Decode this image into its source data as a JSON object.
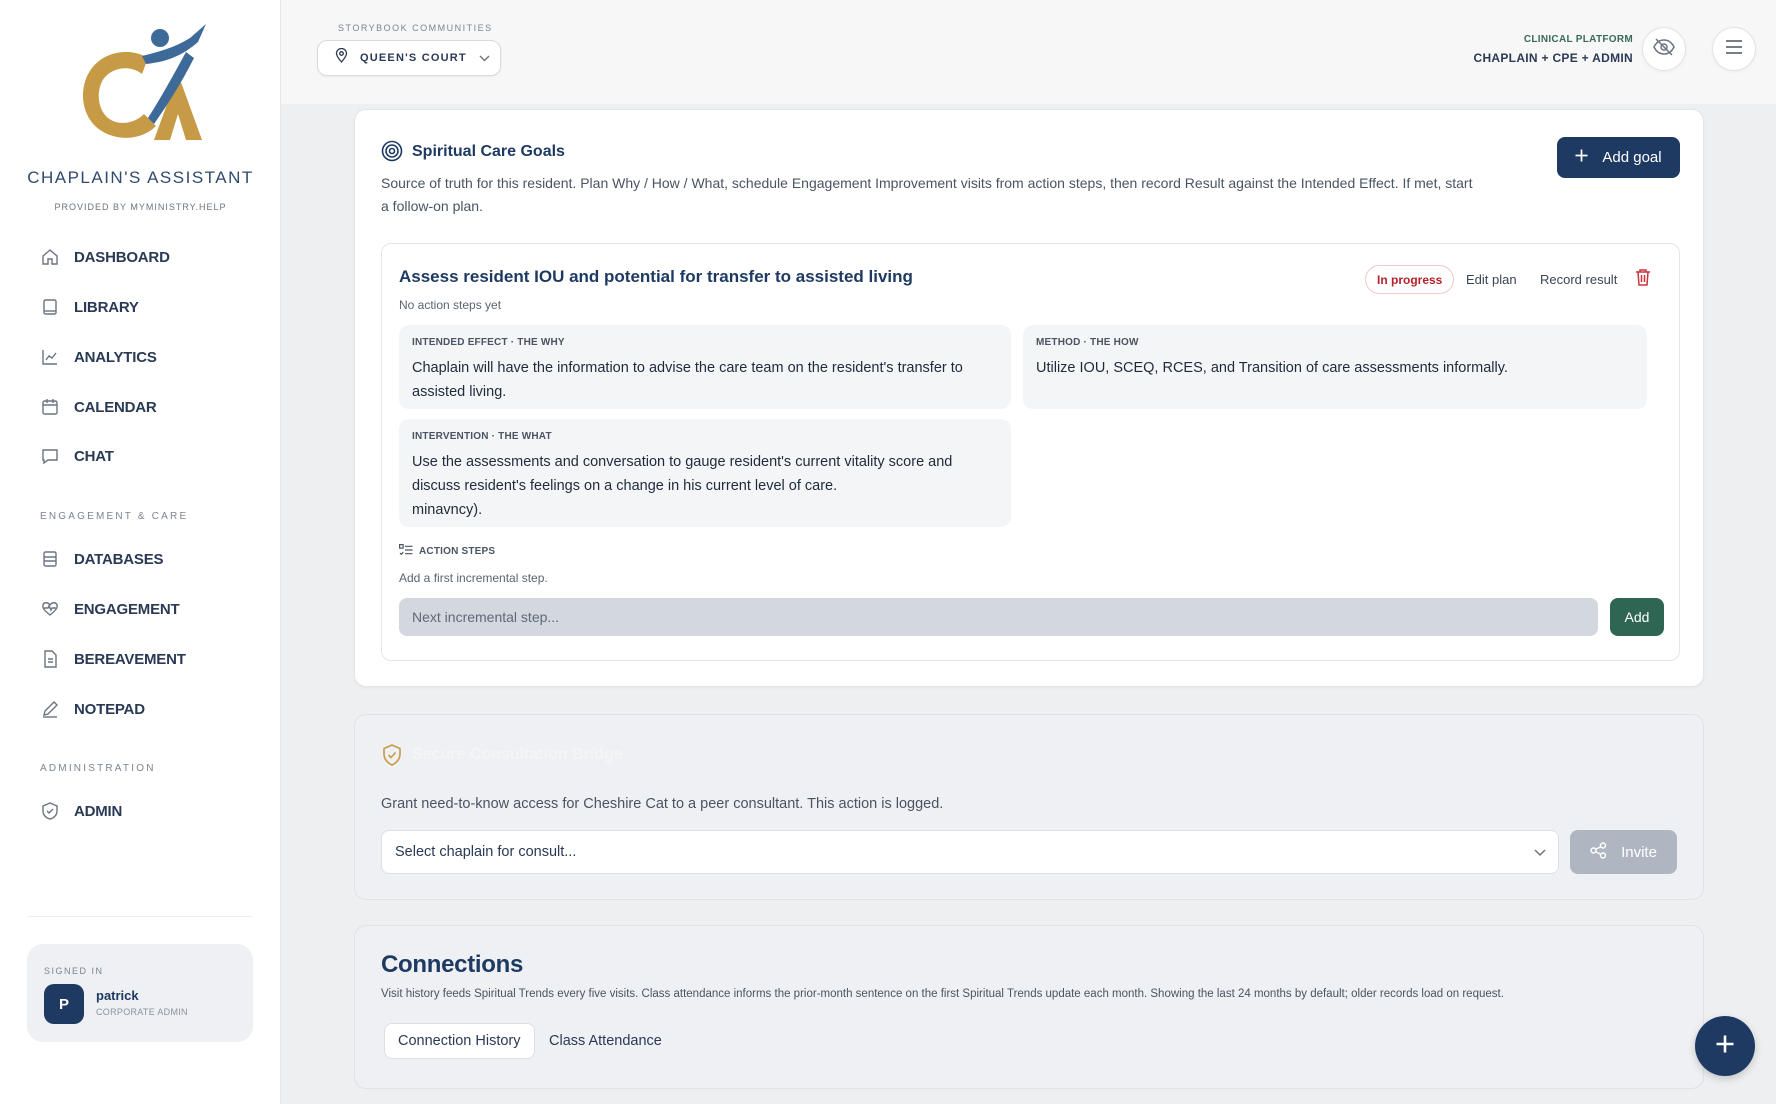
{
  "brand": {
    "name": "CHAPLAIN'S ASSISTANT",
    "provided_by": "PROVIDED BY MYMINISTRY.HELP",
    "colors": {
      "gold": "#c79a45",
      "blue": "#3e6a99",
      "navy": "#1e3a63"
    }
  },
  "sidebar": {
    "main_items": [
      {
        "label": "DASHBOARD",
        "icon": "home-icon"
      },
      {
        "label": "LIBRARY",
        "icon": "book-icon"
      },
      {
        "label": "ANALYTICS",
        "icon": "chart-icon"
      },
      {
        "label": "CALENDAR",
        "icon": "calendar-icon"
      },
      {
        "label": "CHAT",
        "icon": "chat-icon"
      }
    ],
    "section_engagement": "ENGAGEMENT & CARE",
    "engagement_items": [
      {
        "label": "DATABASES",
        "icon": "database-icon"
      },
      {
        "label": "ENGAGEMENT",
        "icon": "heart-pulse-icon"
      },
      {
        "label": "BEREAVEMENT",
        "icon": "document-icon"
      },
      {
        "label": "NOTEPAD",
        "icon": "pencil-icon"
      }
    ],
    "section_admin": "ADMINISTRATION",
    "admin_items": [
      {
        "label": "ADMIN",
        "icon": "shield-icon"
      }
    ],
    "signed_in": {
      "label": "SIGNED IN",
      "avatar_letter": "P",
      "name": "patrick",
      "role": "CORPORATE ADMIN"
    }
  },
  "header": {
    "community_label": "STORYBOOK COMMUNITIES",
    "community_value": "QUEEN'S COURT",
    "platform_label": "CLINICAL PLATFORM",
    "platform_roles": "CHAPLAIN + CPE + ADMIN"
  },
  "goals": {
    "title": "Spiritual Care Goals",
    "description": "Source of truth for this resident. Plan Why / How / What, schedule Engagement Improvement visits from action steps, then record Result against the Intended Effect. If met, start a follow-on plan.",
    "add_goal_label": "Add goal",
    "goal": {
      "title": "Assess resident IOU and potential for transfer to assisted living",
      "subtitle": "No action steps yet",
      "status": "In progress",
      "edit_label": "Edit plan",
      "record_label": "Record result",
      "intended_effect_label": "INTENDED EFFECT · THE WHY",
      "intended_effect": "Chaplain will have the information to advise the care team on the resident's transfer to assisted living.",
      "method_label": "METHOD · THE HOW",
      "method": "Utilize IOU, SCEQ, RCES, and  Transition of care assessments informally.",
      "intervention_label": "INTERVENTION · THE WHAT",
      "intervention_line1": "Use the assessments and conversation to gauge resident's current vitality score and",
      "intervention_line2": "discuss resident's feelings on a change in his current level of care.",
      "intervention_line3": "minavncy).",
      "action_steps_label": "ACTION STEPS",
      "action_steps_hint": "Add a first incremental step.",
      "step_placeholder": "Next incremental step...",
      "step_add_label": "Add"
    }
  },
  "bridge": {
    "title": "Secure Consultation Bridge",
    "description": "Grant need-to-know access for Cheshire Cat to a peer consultant. This action is logged.",
    "select_placeholder": "Select chaplain for consult...",
    "invite_label": "Invite"
  },
  "connections": {
    "title": "Connections",
    "description": "Visit history feeds Spiritual Trends every five visits. Class attendance informs the prior-month sentence on the first Spiritual Trends update each month. Showing the last 24 months by default; older records load on request.",
    "tabs": [
      {
        "label": "Connection History",
        "active": true
      },
      {
        "label": "Class Attendance",
        "active": false
      }
    ]
  }
}
